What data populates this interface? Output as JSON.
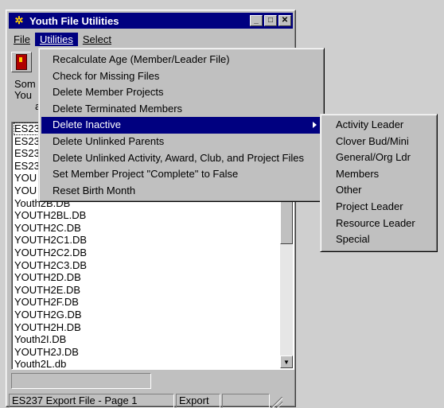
{
  "window": {
    "title": "Youth File Utilities",
    "controls": [
      "_",
      "□",
      "✕"
    ]
  },
  "menubar": [
    {
      "label": "File",
      "underline": "F"
    },
    {
      "label": "Utilities",
      "underline": "U"
    },
    {
      "label": "Select",
      "underline": "S"
    }
  ],
  "info_lines": [
    "Som",
    "You",
    "a"
  ],
  "file_list": [
    "ES23",
    "ES23",
    "ES23",
    "ES23",
    "YOU",
    "YOU",
    "Youth2B.DB",
    "YOUTH2BL.DB",
    "YOUTH2C.DB",
    "YOUTH2C1.DB",
    "YOUTH2C2.DB",
    "YOUTH2C3.DB",
    "YOUTH2D.DB",
    "YOUTH2E.DB",
    "YOUTH2F.DB",
    "YOUTH2G.DB",
    "YOUTH2H.DB",
    "Youth2I.DB",
    "YOUTH2J.DB",
    "Youth2L.db"
  ],
  "utilities_menu": [
    "Recalculate Age  (Member/Leader File)",
    "Check for Missing Files",
    "Delete Member Projects",
    "Delete Terminated Members",
    "Delete Inactive",
    "Delete Unlinked Parents",
    "Delete Unlinked Activity, Award, Club, and Project Files",
    "Set Member Project \"Complete\" to False",
    "Reset Birth Month"
  ],
  "highlighted_menu_index": 4,
  "delete_inactive_submenu": [
    "Activity Leader",
    "Clover Bud/Mini",
    "General/Org Ldr",
    "Members",
    "Other",
    "Project Leader",
    "Resource Leader",
    "Special"
  ],
  "status": {
    "file_label": "ES237 Export File - Page 1",
    "mode": "Export",
    "extra": ""
  },
  "colors": {
    "titlebar": "#000080",
    "face": "#c0c0c0",
    "highlight": "#000080"
  }
}
